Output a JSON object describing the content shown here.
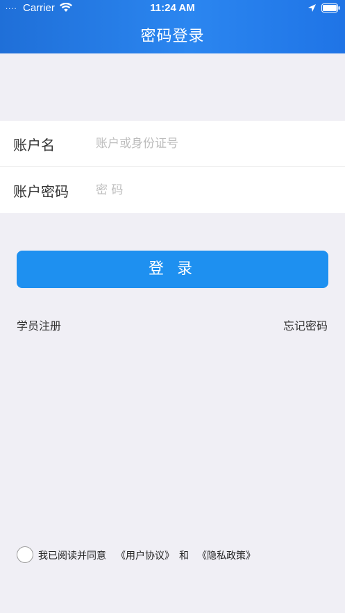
{
  "status_bar": {
    "signal": "....",
    "carrier": "Carrier",
    "time": "11:24 AM"
  },
  "nav": {
    "title": "密码登录"
  },
  "form": {
    "account_label": "账户名",
    "account_placeholder": "账户或身份证号",
    "password_label": "账户密码",
    "password_placeholder": "密 码"
  },
  "actions": {
    "login_label": "登 录",
    "register_label": "学员注册",
    "forgot_label": "忘记密码"
  },
  "agreement": {
    "text": "我已阅读并同意",
    "user_agreement": "《用户协议》",
    "and": "和",
    "privacy_policy": "《隐私政策》",
    "checked": false
  },
  "colors": {
    "header": "#2b86f0",
    "button": "#1e90f0",
    "background": "#f0eff5"
  },
  "icons": [
    "wifi-icon",
    "location-icon",
    "battery-icon"
  ]
}
